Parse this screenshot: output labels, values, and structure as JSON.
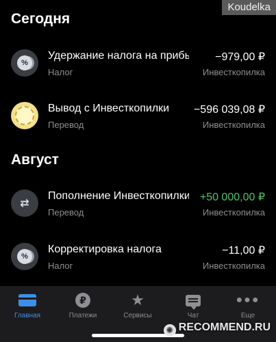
{
  "watermark": {
    "top": "Koudelka",
    "bottom": "RECOMMEND.RU"
  },
  "sections": [
    {
      "title": "Сегодня",
      "items": [
        {
          "icon": "tax-percent-icon",
          "title": "Удержание налога на прибыль",
          "category": "Налог",
          "amount": "−979,00 ₽",
          "account": "Инвесткопилка"
        },
        {
          "icon": "coin-gold-icon",
          "title": "Вывод с Инвесткопилки",
          "category": "Перевод",
          "amount": "−596 039,08 ₽",
          "account": "Инвесткопилка"
        }
      ]
    },
    {
      "title": "Август",
      "items": [
        {
          "icon": "transfer-arrows-icon",
          "title": "Пополнение Инвесткопилки",
          "category": "Перевод",
          "amount": "+50 000,00 ₽",
          "account": "Инвесткопилка"
        },
        {
          "icon": "tax-percent-icon",
          "title": "Корректировка налога",
          "category": "Налог",
          "amount": "−11,00 ₽",
          "account": "Инвесткопилка"
        }
      ]
    }
  ],
  "tabs": [
    {
      "label": "Главная",
      "icon": "card-icon",
      "active": true
    },
    {
      "label": "Платежи",
      "icon": "ruble-icon"
    },
    {
      "label": "Сервисы",
      "icon": "star-icon"
    },
    {
      "label": "Чат",
      "icon": "chat-icon"
    },
    {
      "label": "Еще",
      "icon": "more-dots-icon"
    }
  ],
  "colors": {
    "positive": "#4fc46a",
    "active_tab": "#3f8fe8",
    "secondary_text": "#8e8e93"
  }
}
